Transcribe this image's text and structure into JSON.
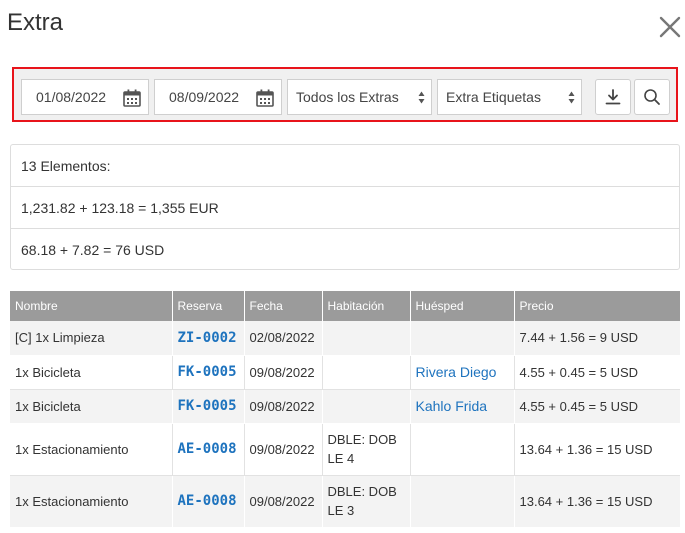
{
  "modal": {
    "title": "Extra"
  },
  "filters": {
    "date_from": "01/08/2022",
    "date_to": "08/09/2022",
    "extras_select": "Todos los Extras",
    "labels_select": "Extra Etiquetas"
  },
  "summary": {
    "count": "13 Elementos:",
    "eur_total": "1,231.82 + 123.18 = 1,355 EUR",
    "usd_total": "68.18 + 7.82 = 76 USD"
  },
  "table": {
    "headers": [
      "Nombre",
      "Reserva",
      "Fecha",
      "Habitación",
      "Huésped",
      "Precio"
    ],
    "rows": [
      {
        "name": "[C] 1x Limpieza",
        "reservation": "ZI-0002",
        "date": "02/08/2022",
        "room": "",
        "guest": "",
        "price": "7.44 + 1.56 = 9 USD"
      },
      {
        "name": "1x Bicicleta",
        "reservation": "FK-0005",
        "date": "09/08/2022",
        "room": "",
        "guest": "Rivera Diego",
        "price": "4.55 + 0.45 = 5 USD"
      },
      {
        "name": "1x Bicicleta",
        "reservation": "FK-0005",
        "date": "09/08/2022",
        "room": "",
        "guest": "Kahlo Frida",
        "price": "4.55 + 0.45 = 5 USD"
      },
      {
        "name": "1x Estacionamiento",
        "reservation": "AE-0008",
        "date": "09/08/2022",
        "room": "DBLE: DOBLE 4",
        "guest": "",
        "price": "13.64 + 1.36 = 15 USD"
      },
      {
        "name": "1x Estacionamiento",
        "reservation": "AE-0008",
        "date": "09/08/2022",
        "room": "DBLE: DOBLE 3",
        "guest": "",
        "price": "13.64 + 1.36 = 15 USD"
      }
    ]
  },
  "colors": {
    "highlight_border": "#e8141b",
    "link": "#1e73be",
    "header_bg": "#9b9b9b"
  },
  "icons": [
    "close-icon",
    "calendar-icon",
    "select-arrows-icon",
    "download-icon",
    "search-icon"
  ]
}
